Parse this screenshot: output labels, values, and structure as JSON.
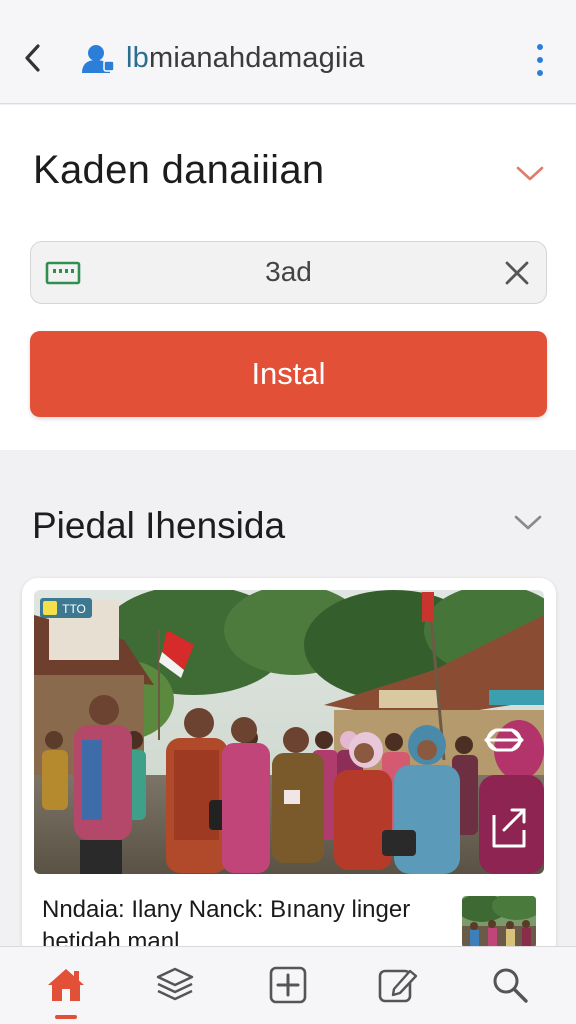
{
  "topbar": {
    "url_prefix": "lb",
    "url_rest": "mianahdamagiia",
    "back_icon": "chevron-left-icon",
    "lock_icon": "user-lock-icon",
    "more_icon": "more-vertical-icon"
  },
  "app": {
    "title": "Kaden danaiiian",
    "input_value": "3ad",
    "install_label": "Instal"
  },
  "section": {
    "title": "Piedal Ihensida"
  },
  "news": {
    "badge": "TTO",
    "headline": "Nndaia: Ilany  Nanck: Bınany linger hetidah manl"
  },
  "bottom_nav": {
    "items": [
      "home-icon",
      "layers-icon",
      "add-square-icon",
      "edit-icon",
      "search-icon"
    ],
    "active": "home-icon"
  },
  "colors": {
    "accent": "#e25038",
    "link_blue": "#2b7fd9"
  }
}
